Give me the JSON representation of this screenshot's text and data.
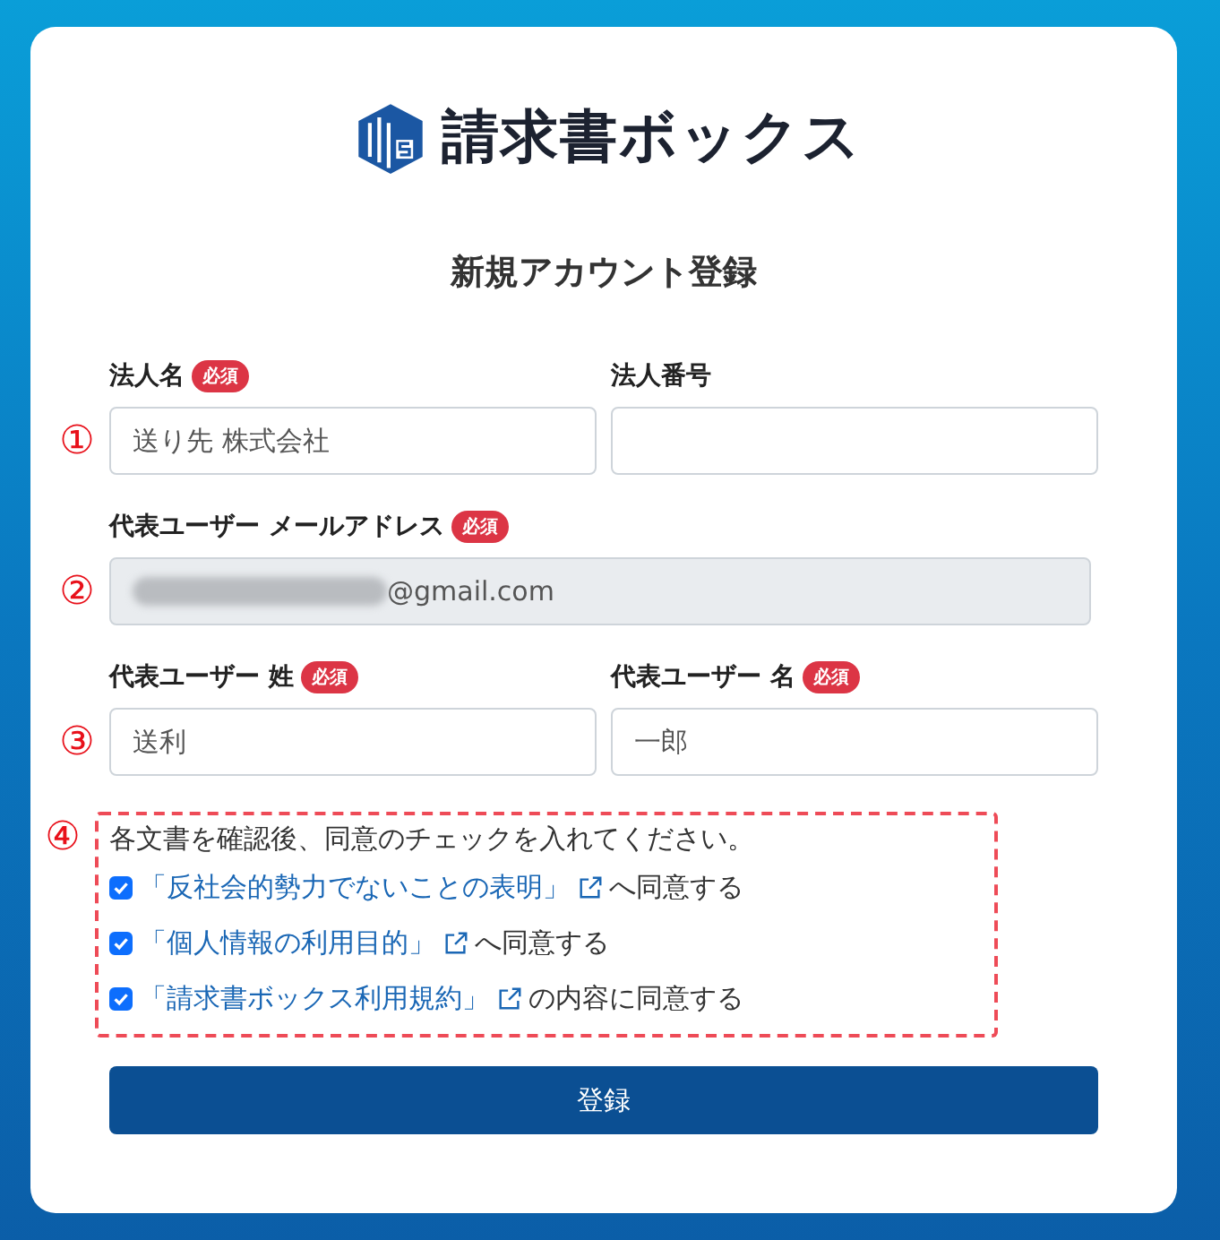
{
  "logo": {
    "text": "請求書ボックス"
  },
  "title": "新規アカウント登録",
  "rows": [
    {
      "marker": "①",
      "fields": [
        {
          "label": "法人名",
          "badge": "必須",
          "kind": "text",
          "value": "送り先 株式会社",
          "disabled": false
        },
        {
          "label": "法人番号",
          "kind": "text",
          "disabled": false
        }
      ]
    },
    {
      "marker": "②",
      "fields": [
        {
          "label": "代表ユーザー メールアドレス",
          "badge": "必須",
          "kind": "redacted-email",
          "value": "@gmail.com",
          "disabled": true
        }
      ]
    },
    {
      "marker": "③",
      "fields": [
        {
          "label": "代表ユーザー 姓",
          "badge": "必須",
          "kind": "text",
          "value": "送利",
          "disabled": false
        },
        {
          "label": "代表ユーザー 名",
          "badge": "必須",
          "kind": "text",
          "value": "一郎",
          "disabled": false
        }
      ]
    }
  ],
  "consent": {
    "marker": "④",
    "intro": "各文書を確認後、同意のチェックを入れてください。",
    "items": [
      {
        "checked": true,
        "link": "「反社会的勢力でないことの表明」",
        "suffix": "へ同意する"
      },
      {
        "checked": true,
        "link": "「個人情報の利用目的」",
        "suffix": "へ同意する"
      },
      {
        "checked": true,
        "link": "「請求書ボックス利用規約」",
        "suffix": "の内容に同意する"
      }
    ]
  },
  "submit": "登録"
}
